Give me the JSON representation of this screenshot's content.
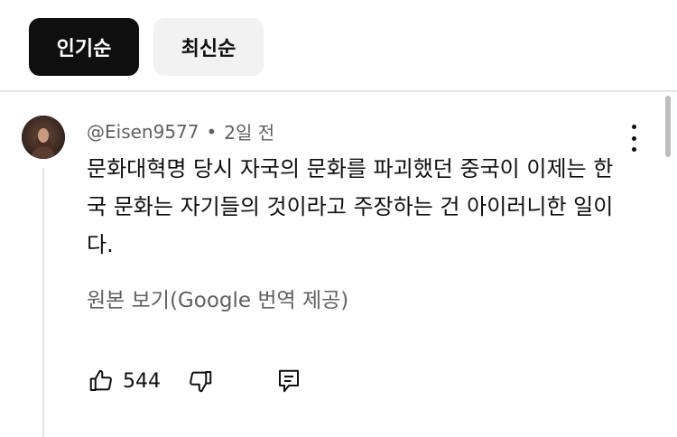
{
  "filters": {
    "popular_label": "인기순",
    "newest_label": "최신순"
  },
  "comment": {
    "author": "@Eisen9577",
    "separator": "•",
    "time": "2일 전",
    "text": "문화대혁명 당시 자국의 문화를 파괴했던 중국이 이제는 한국 문화는 자기들의 것이라고 주장하는 건 아이러니한 일이다.",
    "translate_link": "원본 보기(Google 번역 제공)",
    "like_count": "544"
  },
  "icons": {
    "like": "thumbs-up-icon",
    "dislike": "thumbs-down-icon",
    "reply": "reply-icon",
    "menu": "more-vertical-icon"
  },
  "colors": {
    "active_chip": "#0f0f0f",
    "inactive_chip": "#f2f2f2",
    "secondary_text": "#606060"
  }
}
